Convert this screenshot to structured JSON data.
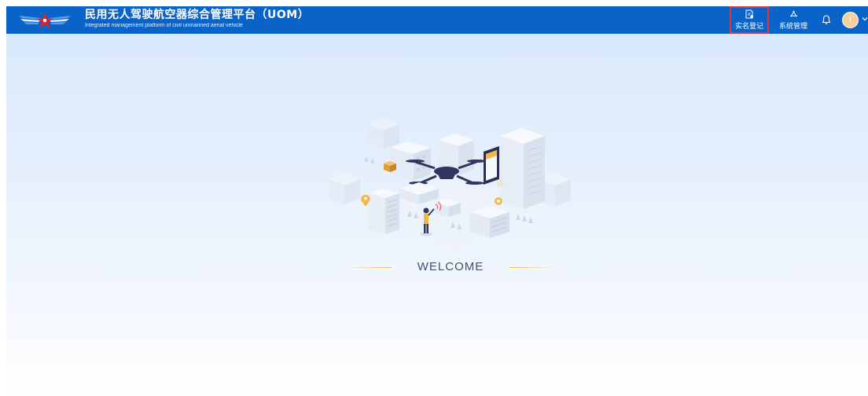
{
  "header": {
    "title_cn": "民用无人驾驶航空器综合管理平台（UOM）",
    "title_en": "Integrated management platform of civil unmanned aerial vehicle",
    "logo_icon": "caac-wings-logo",
    "nav": [
      {
        "label": "实名登记",
        "icon": "document-register-icon",
        "highlighted": true
      },
      {
        "label": "系统管理",
        "icon": "system-management-icon",
        "highlighted": false
      }
    ],
    "notification_icon": "bell-icon",
    "avatar_initial": "I",
    "dropdown_icon": "chevron-down-icon"
  },
  "main": {
    "welcome_text": "WELCOME",
    "illustration": "isometric-city-drone-illustration"
  },
  "colors": {
    "header_bg": "#0a63c9",
    "highlight_border": "#e03838",
    "accent_gold": "#f0b84f",
    "welcome_text": "#4a4f6a"
  }
}
